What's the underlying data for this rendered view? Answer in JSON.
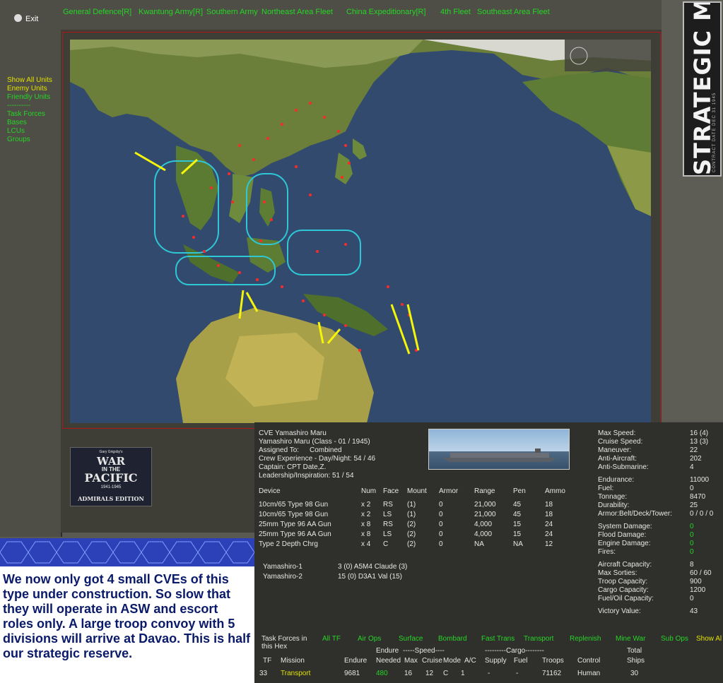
{
  "exit_label": "Exit",
  "hq_links": [
    {
      "label": "General Defence[R]"
    },
    {
      "label": "Kwantung Army[R]"
    },
    {
      "label": "Southern Army"
    },
    {
      "label": "Northeast Area Fleet"
    },
    {
      "label": "China Expeditionary[R]"
    },
    {
      "label": "4th Fleet"
    },
    {
      "label": "Southeast Area Fleet"
    }
  ],
  "filters": [
    {
      "label": "Show All Units"
    },
    {
      "label": "Enemy Units"
    },
    {
      "label": "Friendly Units"
    },
    {
      "label": "----------"
    },
    {
      "label": "Task Forces"
    },
    {
      "label": "Bases"
    },
    {
      "label": "LCUs"
    },
    {
      "label": "Groups"
    }
  ],
  "strategic_map": {
    "title": "STRATEGIC MAP",
    "subtitle": "CONTRACT DATE DEC 31 1945"
  },
  "logo": {
    "top": "Gary Grigsby's",
    "line1": "WAR",
    "line2": "IN THE",
    "line3": "PACIFIC",
    "years": "1941-1945",
    "edition": "ADMIRALS EDITION"
  },
  "caption": "We now only got 4 small CVEs of this type under construction. So slow that they will operate in ASW and escort roles only. A large troop convoy with 5 divisions will arrive at Davao. This is half our strategic reserve.",
  "ship": {
    "name": "CVE Yamashiro Maru",
    "class": "Yamashiro Maru (Class - 01 / 1945)",
    "assigned_label": "Assigned To:",
    "assigned_value": "Combined",
    "crew": "Crew Experience - Day/Night:  54  /  46",
    "captain": "Captain:  CPT Date,Z.",
    "leadership": "Leadership/Inspiration: 51 / 54"
  },
  "stats": [
    {
      "label": "Max Speed:",
      "value": "16  (4)"
    },
    {
      "label": "Cruise Speed:",
      "value": "13  (3)"
    },
    {
      "label": "Maneuver:",
      "value": "22"
    },
    {
      "label": "Anti-Aircraft:",
      "value": "202"
    },
    {
      "label": "Anti-Submarine:",
      "value": "4"
    },
    {
      "label": "Endurance:",
      "value": "11000"
    },
    {
      "label": "Fuel:",
      "value": "0"
    },
    {
      "label": "Tonnage:",
      "value": "8470"
    },
    {
      "label": "Durability:",
      "value": "25"
    },
    {
      "label": "Armor:Belt/Deck/Tower:",
      "value": "0 / 0 / 0"
    },
    {
      "label": "System Damage:",
      "value": "0"
    },
    {
      "label": "Flood Damage:",
      "value": "0"
    },
    {
      "label": "Engine Damage:",
      "value": "0"
    },
    {
      "label": "Fires:",
      "value": "0"
    },
    {
      "label": "Aircraft Capacity:",
      "value": "8"
    },
    {
      "label": "Max Sorties:",
      "value": "60 / 60"
    },
    {
      "label": "Troop Capacity:",
      "value": "900"
    },
    {
      "label": "Cargo Capacity:",
      "value": "1200"
    },
    {
      "label": "Fuel/Oil Capacity:",
      "value": "0"
    },
    {
      "label": "Victory Value:",
      "value": "43"
    }
  ],
  "device_headers": [
    "Device",
    "Num",
    "Face",
    "Mount",
    "Armor",
    "Range",
    "Pen",
    "Ammo"
  ],
  "devices": [
    [
      "10cm/65 Type 98 Gun",
      "x 2",
      "RS",
      "(1)",
      "0",
      "21,000",
      "45",
      "18"
    ],
    [
      "10cm/65 Type 98 Gun",
      "x 2",
      "LS",
      "(1)",
      "0",
      "21,000",
      "45",
      "18"
    ],
    [
      "25mm Type 96 AA Gun",
      "x 8",
      "RS",
      "(2)",
      "0",
      "4,000",
      "15",
      "24"
    ],
    [
      "25mm Type 96 AA Gun",
      "x 8",
      "LS",
      "(2)",
      "0",
      "4,000",
      "15",
      "24"
    ],
    [
      "Type 2 Depth Chrg",
      "x 4",
      "C",
      "(2)",
      "0",
      "NA",
      "NA",
      "12"
    ]
  ],
  "air_groups": [
    {
      "name": "Yamashiro-1",
      "planes": "3 (0) A5M4 Claude (3)"
    },
    {
      "name": "Yamashiro-2",
      "planes": "15 (0) D3A1 Val (15)"
    }
  ],
  "tf_bar": {
    "title": "Task Forces in this Hex",
    "tabs": [
      "All TF",
      "Air Ops",
      "Surface",
      "Bombard",
      "Fast Trans",
      "Transport",
      "Replenish",
      "Mine War",
      "Sub Ops",
      "Show All"
    ]
  },
  "tf_table": {
    "group_row": {
      "endure": "Endure",
      "speed": "-----Speed----",
      "cargo": "---------Cargo--------",
      "total": "Total"
    },
    "headers": [
      "TF",
      "Mission",
      "Endure",
      "Needed",
      "Max",
      "Cruise",
      "Mode",
      "A/C",
      "Supply",
      "Fuel",
      "Troops",
      "Control",
      "Ships"
    ],
    "rows": [
      [
        "33",
        "Transport",
        "9681",
        "480",
        "16",
        "12",
        "C",
        "1",
        "-",
        "-",
        "71162",
        "Human",
        "30"
      ]
    ]
  }
}
